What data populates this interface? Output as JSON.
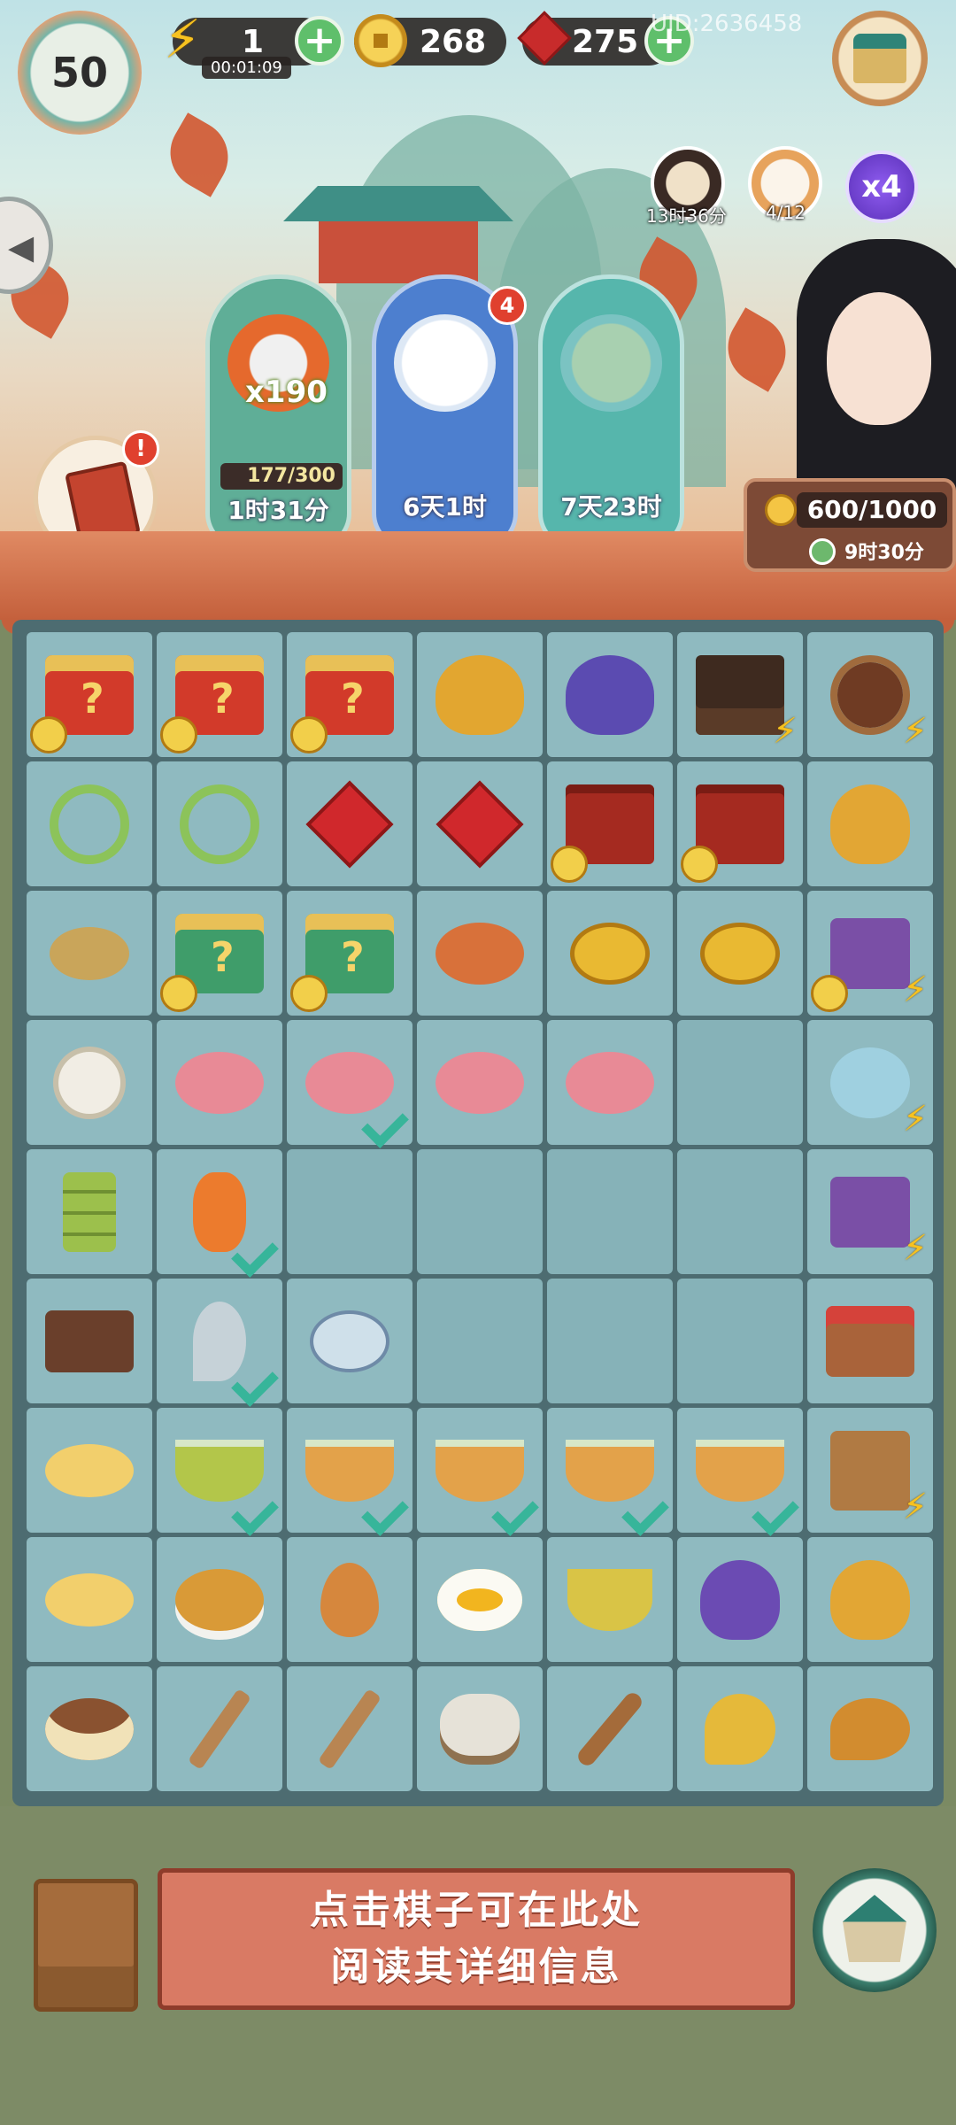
{
  "hud": {
    "level": "50",
    "energy": "1",
    "energy_timer": "00:01:09",
    "coins": "268",
    "rubies": "275",
    "uid": "UID:2636458"
  },
  "side_icons": {
    "cooking_timer": "13时36分",
    "cat_count": "4/12",
    "multiplier": "x4"
  },
  "orders": [
    {
      "multiplier": "x190",
      "progress": "177/300",
      "time": "1时31分"
    },
    {
      "badge": "4",
      "time": "6天1时"
    },
    {
      "time": "7天23时"
    }
  ],
  "character_panel": {
    "amount": "600/1000",
    "time": "9时30分"
  },
  "info": {
    "line1": "点击棋子可在此处",
    "line2": "阅读其详细信息"
  },
  "colors": {
    "board": "#4d6c71",
    "cell": "#8fbac0",
    "banner": "#c4603c",
    "info_box": "#d97a64",
    "check": "#37b59a"
  },
  "board": [
    [
      {
        "item": "red-gift-box",
        "locked": true
      },
      {
        "item": "red-gift-box",
        "locked": true
      },
      {
        "item": "red-gift-box",
        "locked": true
      },
      {
        "item": "gold-energy-jar"
      },
      {
        "item": "purple-energy-jar"
      },
      {
        "item": "treasure-chest",
        "energy": true
      },
      {
        "item": "wooden-root-ornament",
        "energy": true
      }
    ],
    [
      {
        "item": "scissors"
      },
      {
        "item": "scissors"
      },
      {
        "item": "ruby-pair"
      },
      {
        "item": "ruby"
      },
      {
        "item": "red-mystery-box",
        "locked": true
      },
      {
        "item": "red-mystery-box",
        "locked": true
      },
      {
        "item": "hen-on-nest"
      }
    ],
    [
      {
        "item": "dried-leaves"
      },
      {
        "item": "green-gift-box",
        "locked": true
      },
      {
        "item": "green-mystery-bag",
        "locked": true
      },
      {
        "item": "fruit-platter"
      },
      {
        "item": "coin-stack"
      },
      {
        "item": "coin-pair"
      },
      {
        "item": "fabric-bolts",
        "energy": true,
        "locked": true
      }
    ],
    [
      {
        "item": "cotton-flower"
      },
      {
        "item": "flower-cakes"
      },
      {
        "item": "cat-mochi",
        "check": true
      },
      {
        "item": "peach-bun"
      },
      {
        "item": "cat-mochi-pair"
      },
      {
        "item": "empty"
      },
      {
        "item": "teapot-set",
        "energy": true
      }
    ],
    [
      {
        "item": "bamboo-shoots"
      },
      {
        "item": "lantern",
        "check": true
      },
      {
        "item": "empty"
      },
      {
        "item": "empty"
      },
      {
        "item": "empty"
      },
      {
        "item": "empty"
      },
      {
        "item": "silk-loom",
        "energy": true
      }
    ],
    [
      {
        "item": "wooden-box"
      },
      {
        "item": "feather",
        "check": true
      },
      {
        "item": "cloud-charm"
      },
      {
        "item": "empty"
      },
      {
        "item": "empty"
      },
      {
        "item": "empty"
      },
      {
        "item": "fruit-basket"
      }
    ],
    [
      {
        "item": "chicks-nest"
      },
      {
        "item": "green-porridge",
        "check": true
      },
      {
        "item": "mixed-porridge",
        "check": true
      },
      {
        "item": "mixed-porridge",
        "check": true
      },
      {
        "item": "mixed-porridge",
        "check": true
      },
      {
        "item": "mixed-porridge",
        "check": true
      },
      {
        "item": "scroll-stand",
        "energy": true
      }
    ],
    [
      {
        "item": "two-chicks-nest"
      },
      {
        "item": "roast-chicken"
      },
      {
        "item": "brown-egg"
      },
      {
        "item": "fried-egg"
      },
      {
        "item": "fried-rice"
      },
      {
        "item": "purple-pouch"
      },
      {
        "item": "hen-on-nest"
      }
    ],
    [
      {
        "item": "egg-nest"
      },
      {
        "item": "crossed-brushes"
      },
      {
        "item": "paint-brush"
      },
      {
        "item": "yarn-spools"
      },
      {
        "item": "spindle"
      },
      {
        "item": "small-bird"
      },
      {
        "item": "sparrow"
      }
    ]
  ]
}
